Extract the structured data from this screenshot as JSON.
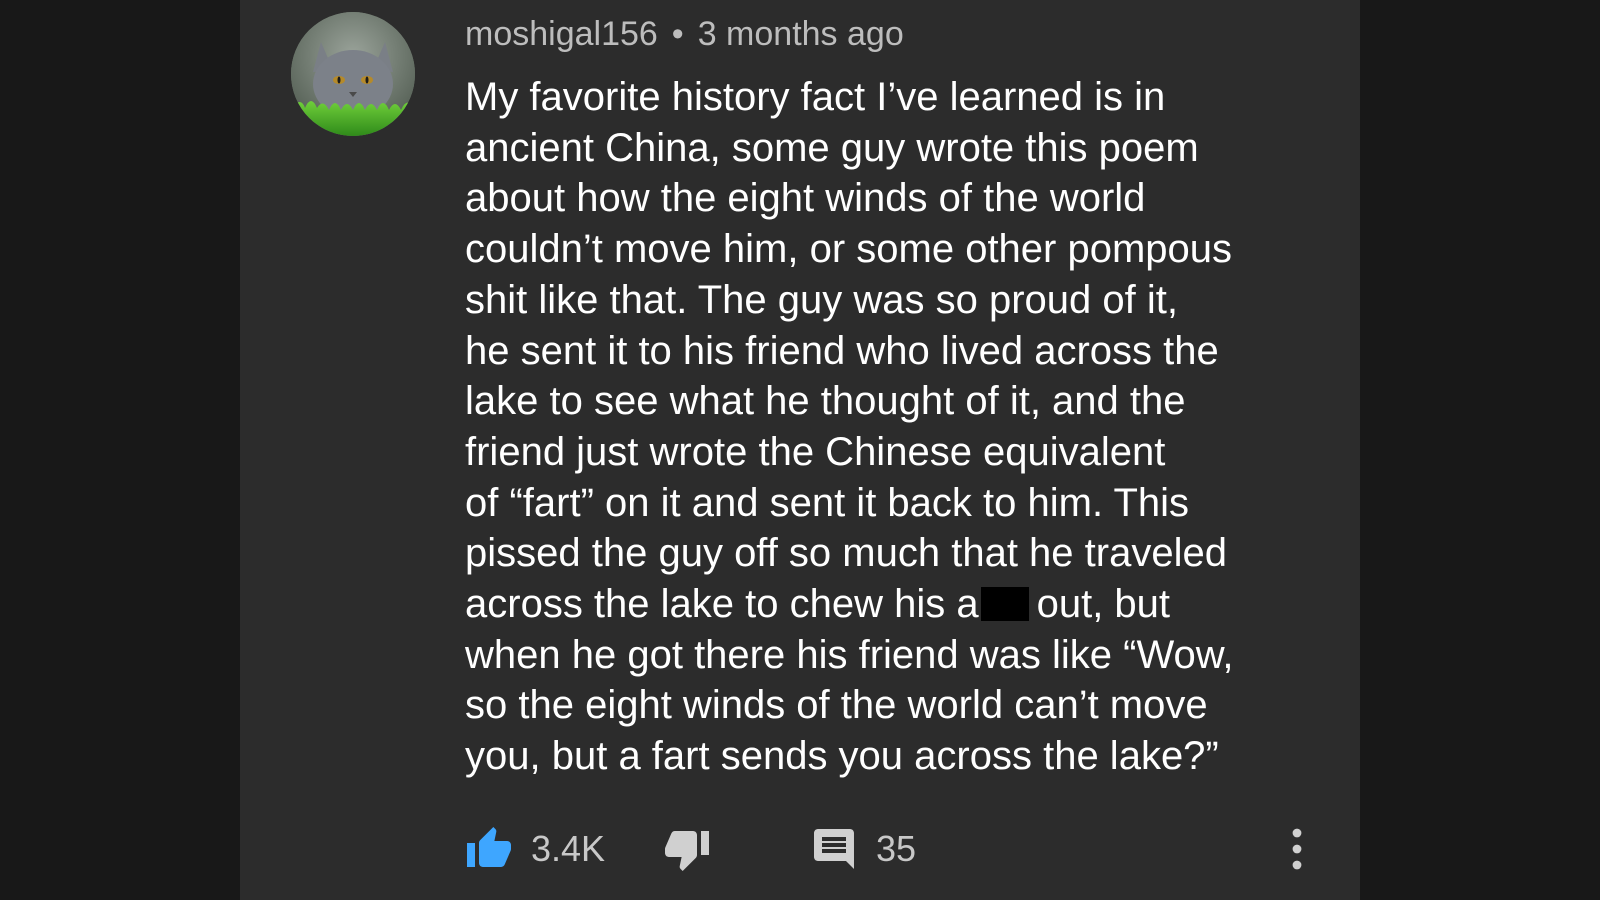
{
  "comment": {
    "author": "moshigal156",
    "separator": "•",
    "timestamp": "3 months ago",
    "lines": [
      "My favorite history fact I’ve learned is in",
      "ancient China, some guy wrote this poem",
      "about how the eight winds of the world",
      "couldn’t move him, or some other pompous",
      "shit like that. The guy was so proud of it,",
      "he sent it to his friend who lived across the",
      "lake to see what he thought of it, and the",
      "friend just wrote the Chinese equivalent",
      "of “fart” on it and sent it back to him. This",
      "pissed the guy off so much that he traveled",
      "across the lake to chew his a",
      "when he got there his friend was like “Wow,",
      "so the eight winds of the world can’t move",
      "you, but a fart sends you across the lake?”"
    ],
    "line11_after_redaction": "out, but",
    "likes": "3.4K",
    "replies": "35"
  },
  "icons": {
    "avatar": "cat-avatar",
    "like": "thumbs-up-icon",
    "dislike": "thumbs-down-icon",
    "reply": "comment-icon",
    "more": "more-vertical-icon"
  },
  "colors": {
    "background": "#181818",
    "panel": "#2c2c2c",
    "like_active": "#3ea6ff",
    "text": "#ffffff",
    "meta_text": "#bdbdbd",
    "icon_muted": "#d0d0d0"
  }
}
